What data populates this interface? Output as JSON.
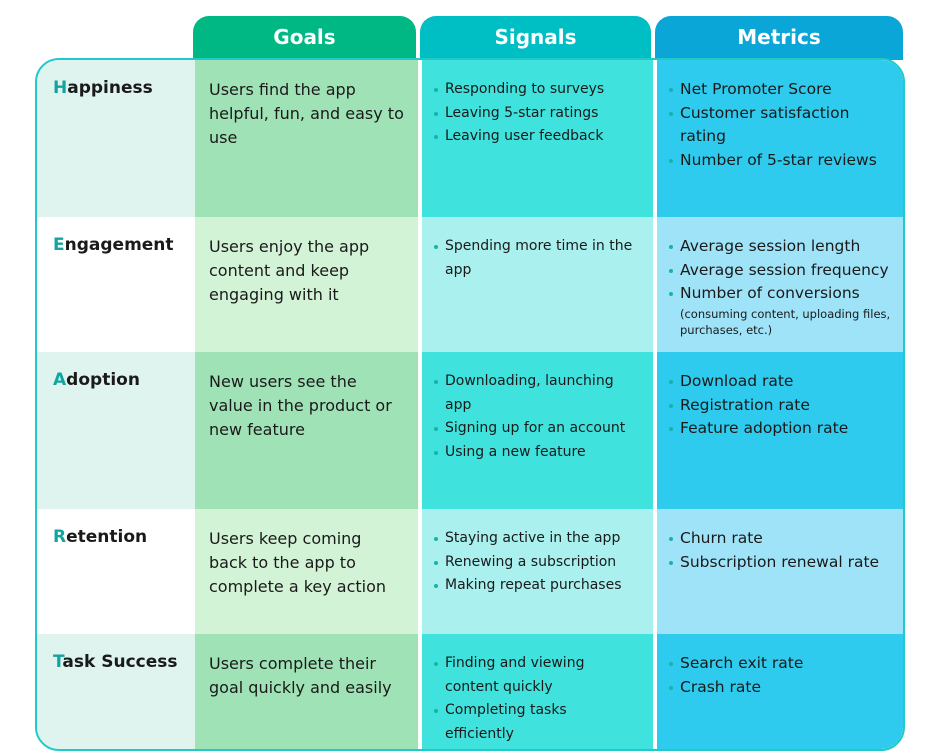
{
  "headers": {
    "goals": "Goals",
    "signals": "Signals",
    "metrics": "Metrics"
  },
  "colors": {
    "goals_header": "#00b884",
    "signals_header": "#00bfc4",
    "metrics_header": "#0aa6d8",
    "accent": "#12a5a0",
    "border": "#22c9c9"
  },
  "rows": [
    {
      "initial": "H",
      "rest": "appiness",
      "goal": "Users find the app helpful, fun, and easy to use",
      "signals": [
        "Responding to surveys",
        "Leaving 5-star ratings",
        "Leaving user feedback"
      ],
      "metrics": [
        "Net Promoter Score",
        "Customer satisfaction rating",
        "Number of 5-star reviews"
      ]
    },
    {
      "initial": "E",
      "rest": "ngagement",
      "goal": "Users enjoy the app content and keep engaging with it",
      "signals": [
        "Spending more time in the app"
      ],
      "metrics": [
        "Average session length",
        "Average session frequency",
        "Number of conversions"
      ],
      "metrics_note": "(consuming content, uploading files, purchases, etc.)"
    },
    {
      "initial": "A",
      "rest": "doption",
      "goal": "New users see the value in the product or new feature",
      "signals": [
        "Downloading, launching app",
        "Signing up for an account",
        "Using a new feature"
      ],
      "metrics": [
        "Download rate",
        "Registration rate",
        "Feature adoption rate"
      ]
    },
    {
      "initial": "R",
      "rest": "etention",
      "goal": "Users keep coming back to the app to complete a key action",
      "signals": [
        "Staying active in the app",
        "Renewing a subscription",
        "Making repeat purchases"
      ],
      "metrics": [
        "Churn rate",
        "Subscription renewal rate"
      ]
    },
    {
      "initial": "T",
      "rest": "ask Success",
      "goal": "Users complete their goal quickly and easily",
      "signals": [
        "Finding and viewing content quickly",
        "Completing tasks efficiently"
      ],
      "metrics": [
        "Search exit rate",
        "Crash rate"
      ]
    }
  ]
}
